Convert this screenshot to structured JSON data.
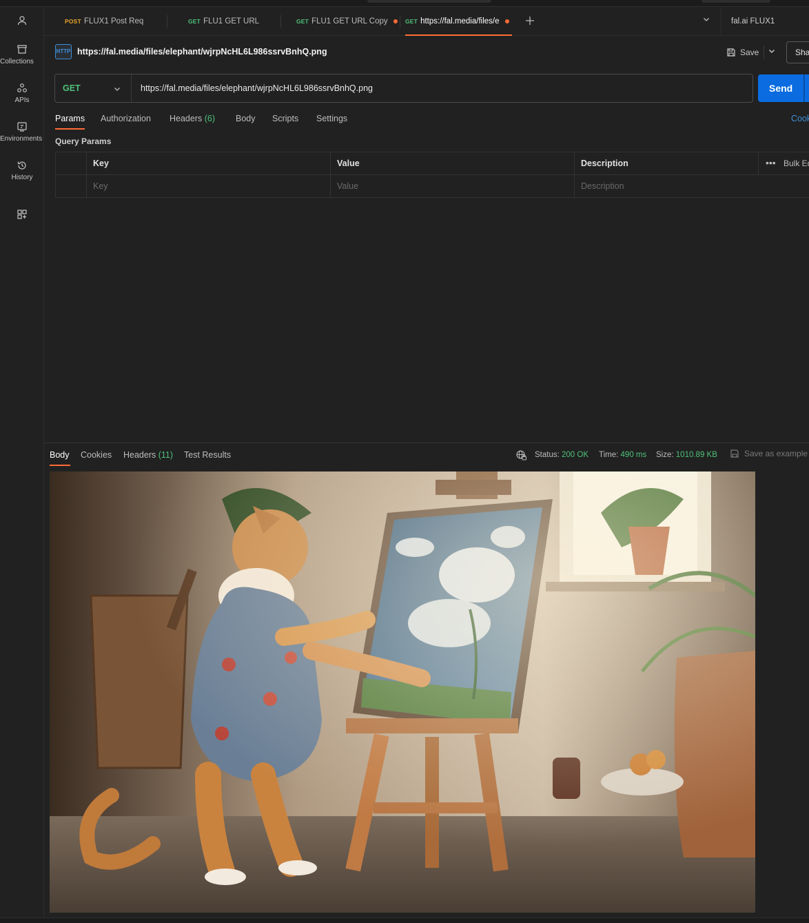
{
  "sidebar": {
    "items": [
      {
        "label": "Collections",
        "icon": "collections-icon"
      },
      {
        "label": "APIs",
        "icon": "apis-icon"
      },
      {
        "label": "Environments",
        "icon": "environments-icon"
      },
      {
        "label": "History",
        "icon": "history-icon"
      }
    ]
  },
  "tabs": [
    {
      "method": "POST",
      "title": "FLUX1 Post Req",
      "method_color": "#e6a42b",
      "unsaved": false,
      "active": false
    },
    {
      "method": "GET",
      "title": "FLU1 GET URL",
      "method_color": "#4fc17a",
      "unsaved": false,
      "active": false
    },
    {
      "method": "GET",
      "title": "FLU1 GET URL Copy",
      "method_color": "#4fc17a",
      "unsaved": true,
      "active": false
    },
    {
      "method": "GET",
      "title": "https://fal.media/files/e",
      "method_color": "#4fc17a",
      "unsaved": true,
      "active": true
    }
  ],
  "environment": "fal.ai FLUX1",
  "request": {
    "badge": "HTTP",
    "title": "https://fal.media/files/elephant/wjrpNcHL6L986ssrvBnhQ.png",
    "save_label": "Save",
    "share_label": "Share",
    "method": "GET",
    "url": "https://fal.media/files/elephant/wjrpNcHL6L986ssrvBnhQ.png",
    "send_label": "Send",
    "tabs": {
      "params": "Params",
      "authorization": "Authorization",
      "headers": "Headers",
      "headers_count": "(6)",
      "body": "Body",
      "scripts": "Scripts",
      "settings": "Settings",
      "cookies": "Cookies"
    },
    "query_params_title": "Query Params",
    "table": {
      "headers": [
        "Key",
        "Value",
        "Description"
      ],
      "placeholders": [
        "Key",
        "Value",
        "Description"
      ],
      "bulk_edit": "Bulk Edit",
      "more": "•••"
    }
  },
  "response": {
    "tabs": {
      "body": "Body",
      "cookies": "Cookies",
      "headers": "Headers",
      "headers_count": "(11)",
      "test_results": "Test Results"
    },
    "status_label": "Status:",
    "status_value": "200 OK",
    "time_label": "Time:",
    "time_value": "490 ms",
    "size_label": "Size:",
    "size_value": "1010.89 KB",
    "save_example": "Save as example"
  },
  "colors": {
    "accent": "#ff6c37",
    "send": "#0a6ce0",
    "get": "#4fc17a",
    "post": "#e6a42b",
    "link": "#3d8fd8"
  }
}
